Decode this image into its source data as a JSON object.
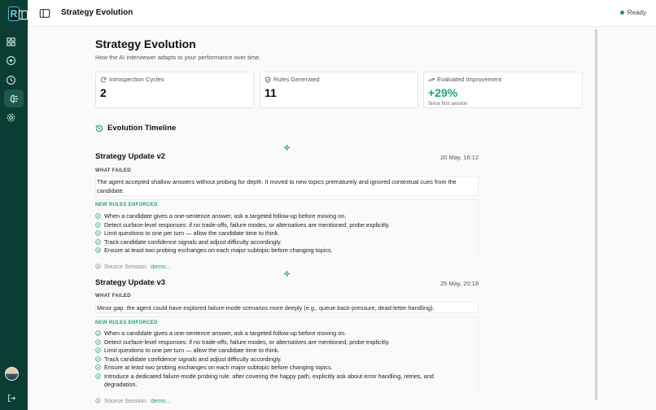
{
  "topbar": {
    "title": "Strategy Evolution",
    "status": "Ready"
  },
  "page": {
    "title": "Strategy Evolution",
    "subtitle": "How the AI interviewer adapts to your performance over time."
  },
  "stats": [
    {
      "label": "Introspection Cycles",
      "value": "2",
      "note": "",
      "icon": "refresh-icon"
    },
    {
      "label": "Rules Generated",
      "value": "11",
      "note": "",
      "icon": "shield-check-icon"
    },
    {
      "label": "Evaluated Improvement",
      "value": "+29%",
      "note": "Since first session",
      "icon": "trending-up-icon"
    }
  ],
  "timeline": {
    "title": "Evolution Timeline",
    "updates": [
      {
        "title": "Strategy Update v2",
        "date": "20 May, 16:12",
        "failed_label": "WHAT FAILED",
        "failed_text": "The agent accepted shallow answers without probing for depth. It moved to new topics prematurely and ignored contextual cues from the candidate.",
        "rules_label": "NEW RULES ENFORCED",
        "rules": [
          "When a candidate gives a one-sentence answer, ask a targeted follow-up before moving on.",
          "Detect surface-level responses: if no trade-offs, failure modes, or alternatives are mentioned, probe explicitly.",
          "Limit questions to one per turn — allow the candidate time to think.",
          "Track candidate confidence signals and adjust difficulty accordingly.",
          "Ensure at least two probing exchanges on each major subtopic before changing topics."
        ],
        "source_label": "Source Session:",
        "source_link": "demo..."
      },
      {
        "title": "Strategy Update v3",
        "date": "25 May, 20:18",
        "failed_label": "WHAT FAILED",
        "failed_text": "Minor gap: the agent could have explored failure-mode scenarios more deeply (e.g., queue back-pressure, dead-letter handling).",
        "rules_label": "NEW RULES ENFORCED",
        "rules": [
          "When a candidate gives a one-sentence answer, ask a targeted follow-up before moving on.",
          "Detect surface-level responses: if no trade-offs, failure modes, or alternatives are mentioned, probe explicitly.",
          "Limit questions to one per turn — allow the candidate time to think.",
          "Track candidate confidence signals and adjust difficulty accordingly.",
          "Ensure at least two probing exchanges on each major subtopic before changing topics.",
          "Introduce a dedicated failure-mode probing rule: after covering the happy path, explicitly ask about error handling, retries, and degradation."
        ],
        "source_label": "Source Session:",
        "source_link": "demo..."
      }
    ]
  },
  "colors": {
    "rail": "#0b3d35",
    "accent": "#17a57a",
    "status": "#16a34a"
  }
}
